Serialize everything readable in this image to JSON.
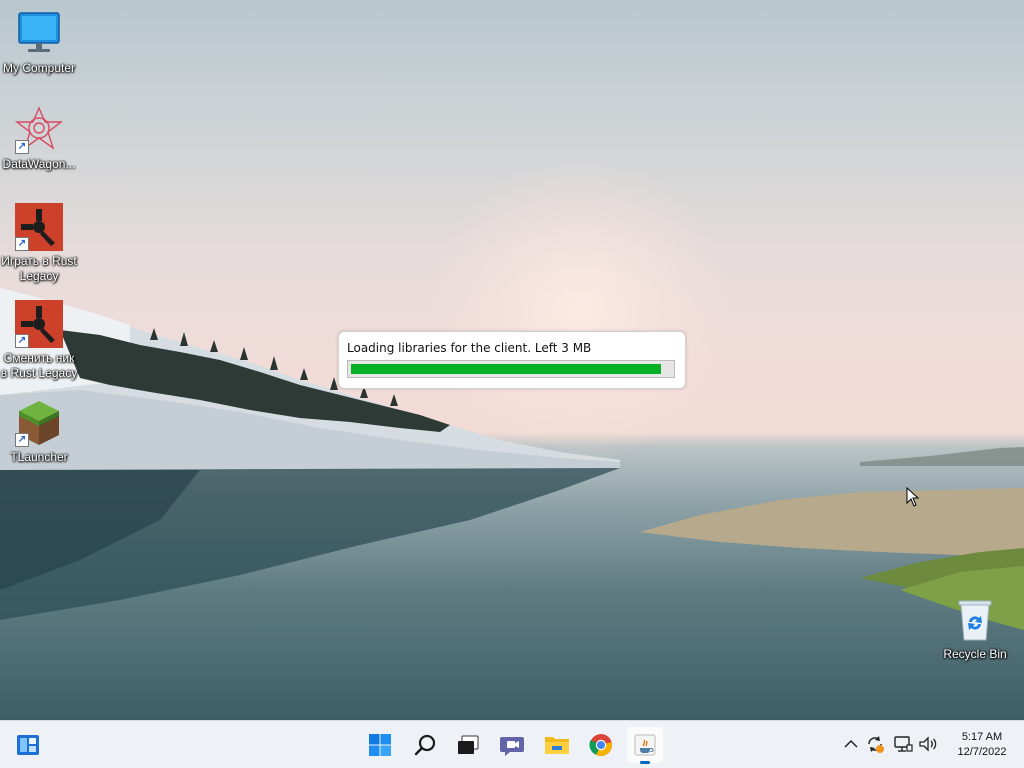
{
  "desktop": {
    "icons": [
      {
        "label": "My Computer",
        "icon": "monitor-icon"
      },
      {
        "label": "DataWagon...",
        "icon": "datawagon-logo-icon"
      },
      {
        "label": "Играть в Rust Legacy",
        "icon": "rust-logo-icon"
      },
      {
        "label": "Сменить ник в Rust Legacy",
        "icon": "rust-logo-icon"
      },
      {
        "label": "TLauncher",
        "icon": "minecraft-block-icon"
      },
      {
        "label": "Recycle Bin",
        "icon": "recycle-bin-icon"
      }
    ]
  },
  "loader": {
    "message": "Loading libraries for the client. Left 3 MB",
    "progress": 0.97,
    "color": "#06b025"
  },
  "taskbar": {
    "apps": [
      {
        "name": "widgets",
        "icon": "widgets-icon"
      },
      {
        "name": "start",
        "icon": "windows-start-icon"
      },
      {
        "name": "search",
        "icon": "search-icon"
      },
      {
        "name": "task-view",
        "icon": "task-view-icon"
      },
      {
        "name": "chat",
        "icon": "teams-chat-icon"
      },
      {
        "name": "file-explorer",
        "icon": "folder-icon"
      },
      {
        "name": "chrome",
        "icon": "chrome-icon"
      },
      {
        "name": "java",
        "icon": "java-icon",
        "active": true
      }
    ],
    "tray": {
      "icons": [
        "chevron-up-icon",
        "sync-icon",
        "network-icon",
        "volume-icon"
      ],
      "time": "5:17 AM",
      "date": "12/7/2022"
    }
  }
}
